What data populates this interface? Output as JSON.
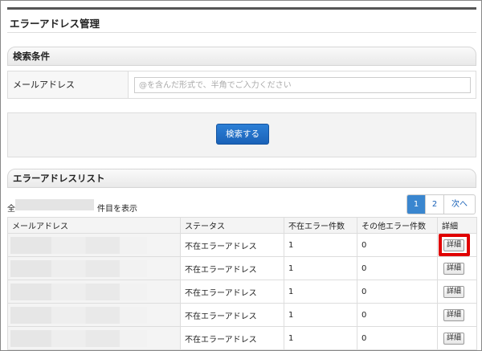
{
  "page": {
    "title": "エラーアドレス管理"
  },
  "search": {
    "section_title": "検索条件",
    "email_label": "メールアドレス",
    "email_placeholder": "@を含んだ形式で、半角でご入力ください",
    "email_value": "",
    "button_label": "検索する"
  },
  "list": {
    "section_title": "エラーアドレスリスト",
    "count_prefix": "全",
    "count_suffix": "件目を表示",
    "pagination": {
      "pages": [
        "1",
        "2"
      ],
      "current": "1",
      "next_label": "次へ"
    },
    "columns": [
      "メールアドレス",
      "ステータス",
      "不在エラー件数",
      "その他エラー件数",
      "詳細"
    ],
    "rows": [
      {
        "status": "不在エラーアドレス",
        "absent_count": "1",
        "other_count": "0",
        "detail_label": "詳細"
      },
      {
        "status": "不在エラーアドレス",
        "absent_count": "1",
        "other_count": "0",
        "detail_label": "詳細"
      },
      {
        "status": "不在エラーアドレス",
        "absent_count": "1",
        "other_count": "0",
        "detail_label": "詳細"
      },
      {
        "status": "不在エラーアドレス",
        "absent_count": "1",
        "other_count": "0",
        "detail_label": "詳細"
      },
      {
        "status": "不在エラーアドレス",
        "absent_count": "1",
        "other_count": "0",
        "detail_label": "詳細"
      }
    ]
  },
  "colors": {
    "primary_button": "#1a62b8",
    "highlight": "#e00000"
  }
}
